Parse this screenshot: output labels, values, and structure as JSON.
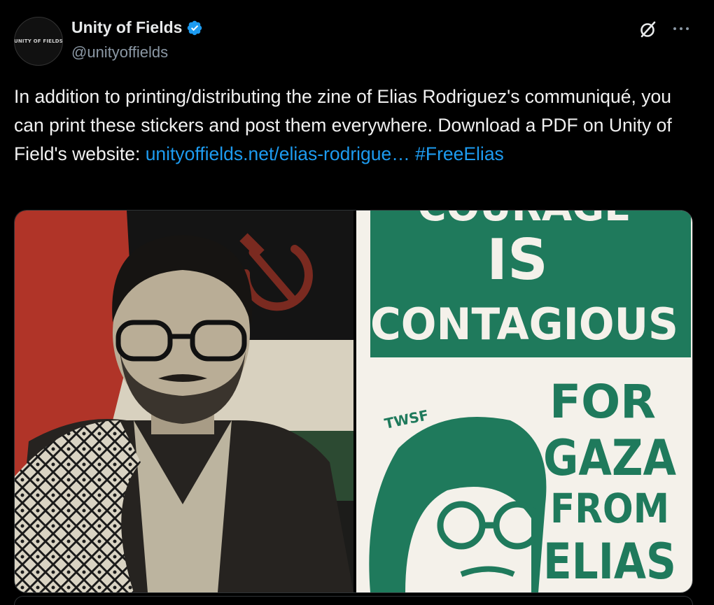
{
  "tweet": {
    "avatar_text": "UNITY OF FIELDS",
    "display_name": "Unity of Fields",
    "handle": "@unityoffields",
    "text_main": "In addition to printing/distributing the zine of Elias Rodriguez's communiqué, you can print these stickers and post them everywhere. Download a PDF on Unity of Field's website: ",
    "link_text": "unityoffields.net/elias-rodrigue…",
    "hashtag": "#FreeElias"
  },
  "media": {
    "right_poster": {
      "line_top": "COURAGE",
      "line_is": "IS",
      "line_contagious": "CONTAGIOUS",
      "line_for": "FOR",
      "line_gaza": "GAZA",
      "line_from": "FROM",
      "line_elias": "ELIAS",
      "tag": "TWSF"
    }
  },
  "colors": {
    "background": "#000000",
    "text": "#e7e9ea",
    "muted": "#8b98a5",
    "link": "#1d9bf0",
    "poster_green": "#1f7a5c",
    "flag_red": "#b03428",
    "flag_green": "#2c4a32",
    "sepia": "#d9d3c3"
  },
  "icons": [
    "verified-badge-icon",
    "grok-icon",
    "more-options-icon"
  ]
}
